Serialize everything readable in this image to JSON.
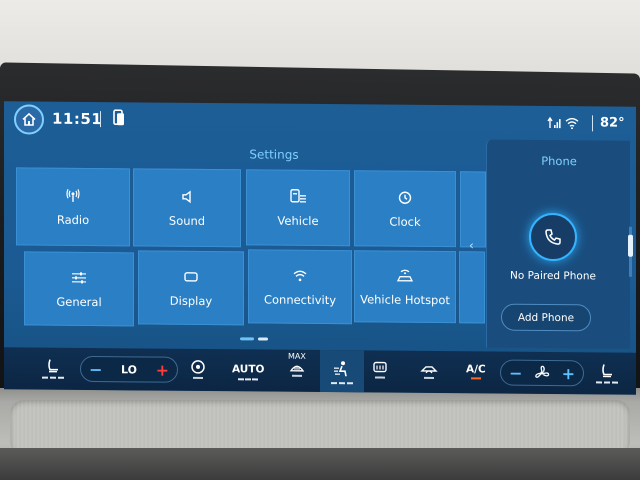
{
  "status": {
    "time": "11:51",
    "temperature": "82°"
  },
  "settings": {
    "title": "Settings",
    "tiles": [
      {
        "label": "Radio",
        "icon": "radio-icon"
      },
      {
        "label": "Sound",
        "icon": "speaker-icon"
      },
      {
        "label": "Vehicle",
        "icon": "vehicle-settings-icon"
      },
      {
        "label": "Clock",
        "icon": "clock-icon"
      },
      {
        "label": "General",
        "icon": "sliders-icon"
      },
      {
        "label": "Display",
        "icon": "display-icon"
      },
      {
        "label": "Connectivity",
        "icon": "wifi-icon"
      },
      {
        "label": "Vehicle Hotspot",
        "icon": "hotspot-icon"
      }
    ]
  },
  "phone": {
    "title": "Phone",
    "status": "No Paired Phone",
    "add_button": "Add Phone"
  },
  "climate": {
    "left_temp": "LO",
    "auto_label": "AUTO",
    "max_label": "MAX",
    "ac_label": "A/C"
  },
  "colors": {
    "screen_bg": "#1d5e97",
    "tile_bg": "#2b7fc4",
    "accent": "#7fd0ff",
    "heat_red": "#ff3b3b",
    "status_orange": "#ff6a2a"
  }
}
